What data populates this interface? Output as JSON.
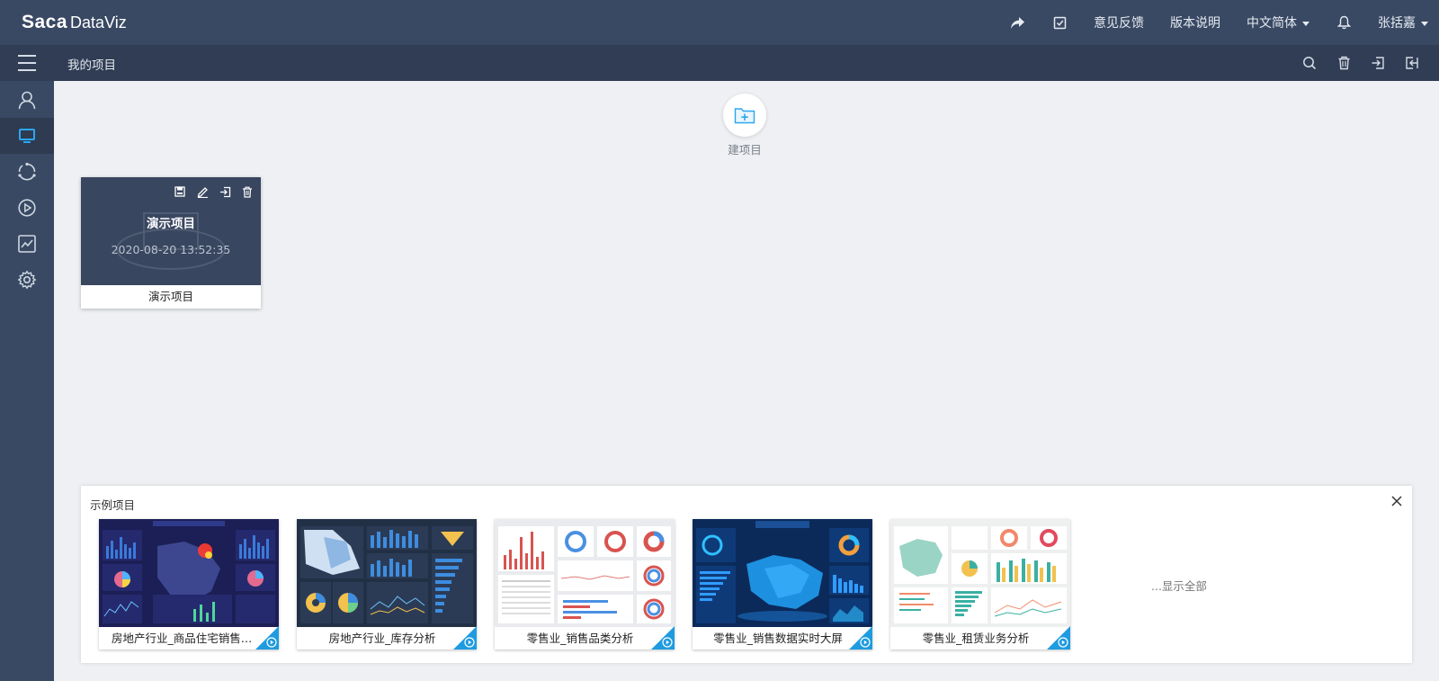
{
  "app": {
    "logo_main": "Saca",
    "logo_sub": "DataViz"
  },
  "topnav": {
    "share_icon": "share-icon",
    "checkbox_icon": "checklist-icon",
    "feedback": "意见反馈",
    "release_notes": "版本说明",
    "language": "中文简体",
    "bell_icon": "bell-icon",
    "user": "张括嘉"
  },
  "subbar": {
    "breadcrumb": "我的项目",
    "icons": [
      "search-icon",
      "trash-icon",
      "import-icon",
      "export-icon"
    ]
  },
  "sidebar": {
    "items": [
      "user-icon",
      "monitor-icon",
      "refresh-cycle-icon",
      "play-icon",
      "chart-icon",
      "gear-icon"
    ],
    "active_index": 1
  },
  "new_project": {
    "label": "建项目"
  },
  "projects": [
    {
      "title": "演示项目",
      "date": "2020-08-20 13:52:35",
      "name": "演示项目"
    }
  ],
  "examples": {
    "header": "示例项目",
    "show_all": "...显示全部",
    "items": [
      {
        "label": "房地产行业_商品住宅销售分...",
        "theme": "#1c1f55"
      },
      {
        "label": "房地产行业_库存分析",
        "theme": "#223046"
      },
      {
        "label": "零售业_销售品类分析",
        "theme": "#e9ebee"
      },
      {
        "label": "零售业_销售数据实时大屏",
        "theme": "#0b2a5a"
      },
      {
        "label": "零售业_租赁业务分析",
        "theme": "#eef0f0"
      }
    ]
  },
  "colors": {
    "topbar": "#394963",
    "subbar": "#303d54",
    "accent": "#1f9be0",
    "background": "#eef0f3"
  }
}
